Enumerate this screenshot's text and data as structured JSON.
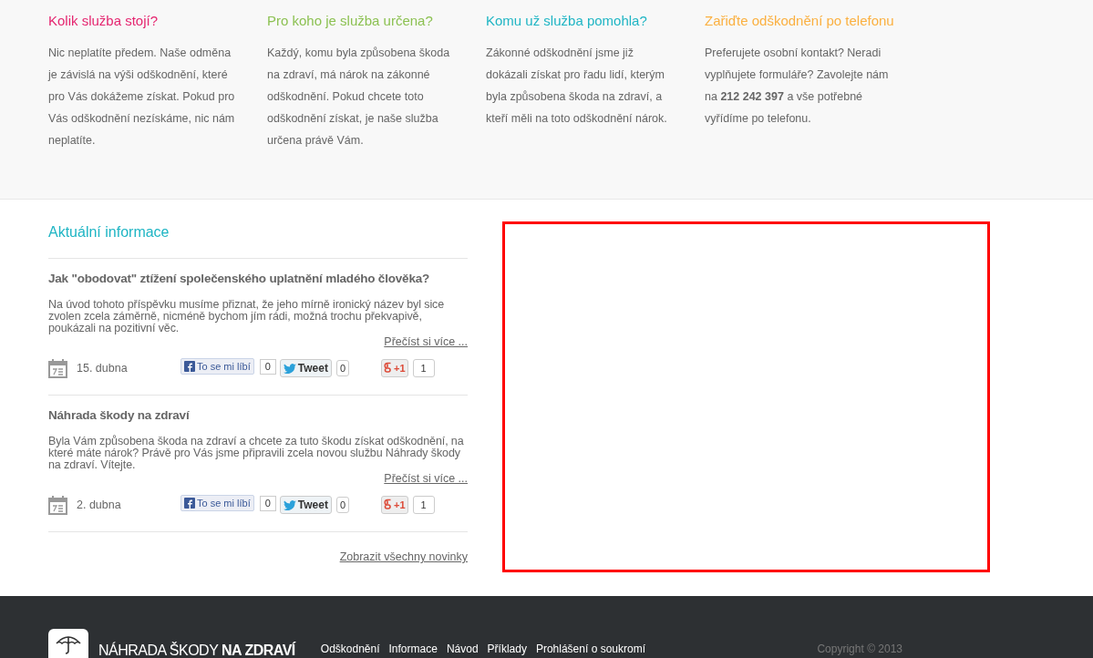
{
  "info_columns": [
    {
      "title": "Kolik služba stojí?",
      "color": "#e5256f",
      "text": "Nic neplatíte předem. Naše odměna je závislá na výši odškodnění, které pro Vás dokážeme získat. Pokud pro Vás odškodnění nezískáme, nic nám neplatíte."
    },
    {
      "title": "Pro koho je služba určena?",
      "color": "#8cc152",
      "text": "Každý, komu byla způsobena škoda na zdraví, má nárok na zákonné odškodnění. Pokud chcete toto odškodnění získat, je naše služba určena právě Vám."
    },
    {
      "title": "Komu už služba pomohla?",
      "color": "#1fb5c4",
      "text": "Zákonné odškodnění jsme již dokázali získat pro řadu lidí, kterým byla způsobena škoda na zdraví, a kteří měli na toto odškodnění nárok."
    },
    {
      "title": "Zařiďte odškodnění po telefonu",
      "color": "#fbb040",
      "text": "Preferujete osobní kontakt? Neradi vyplňujete formuláře? Zavolejte nám na **212 242 397** a vše potřebné vyřídíme po telefonu."
    }
  ],
  "news": {
    "title": "Aktuální informace",
    "items": [
      {
        "title": "Jak \"obodovat\" ztížení společenského uplatnění mladého člověka?",
        "text": "Na úvod tohoto příspěvku musíme přiznat, že jeho mírně ironický název byl sice zvolen zcela záměrně, nicméně bychom jím rádi, možná trochu překvapivě, poukázali na pozitivní věc.",
        "more": "Přečíst si více ...",
        "date": "15. dubna",
        "like_label": "To se mi líbí",
        "like_count": "0",
        "tweet_label": "Tweet",
        "tweet_count": "0",
        "plus_label": "+1",
        "plus_count": "1"
      },
      {
        "title": "Náhrada škody na zdraví",
        "text": "Byla Vám způsobena škoda na zdraví a chcete za tuto škodu získat odškodnění, na které máte nárok? Právě pro Vás jsme připravili zcela novou službu Náhrady škody na zdraví. Vítejte.",
        "more": "Přečíst si více ...",
        "date": "2. dubna",
        "like_label": "To se mi líbí",
        "like_count": "0",
        "tweet_label": "Tweet",
        "tweet_count": "0",
        "plus_label": "+1",
        "plus_count": "1"
      }
    ],
    "all_link": "Zobrazit všechny novinky"
  },
  "footer": {
    "brand": "NÁHRADA ŠKODY **NA ZDRAVÍ**",
    "links": [
      "Odškodnění",
      "Informace",
      "Návod",
      "Příklady",
      "Prohlášení o soukromí"
    ],
    "copyright": "Copyright © 2013"
  }
}
